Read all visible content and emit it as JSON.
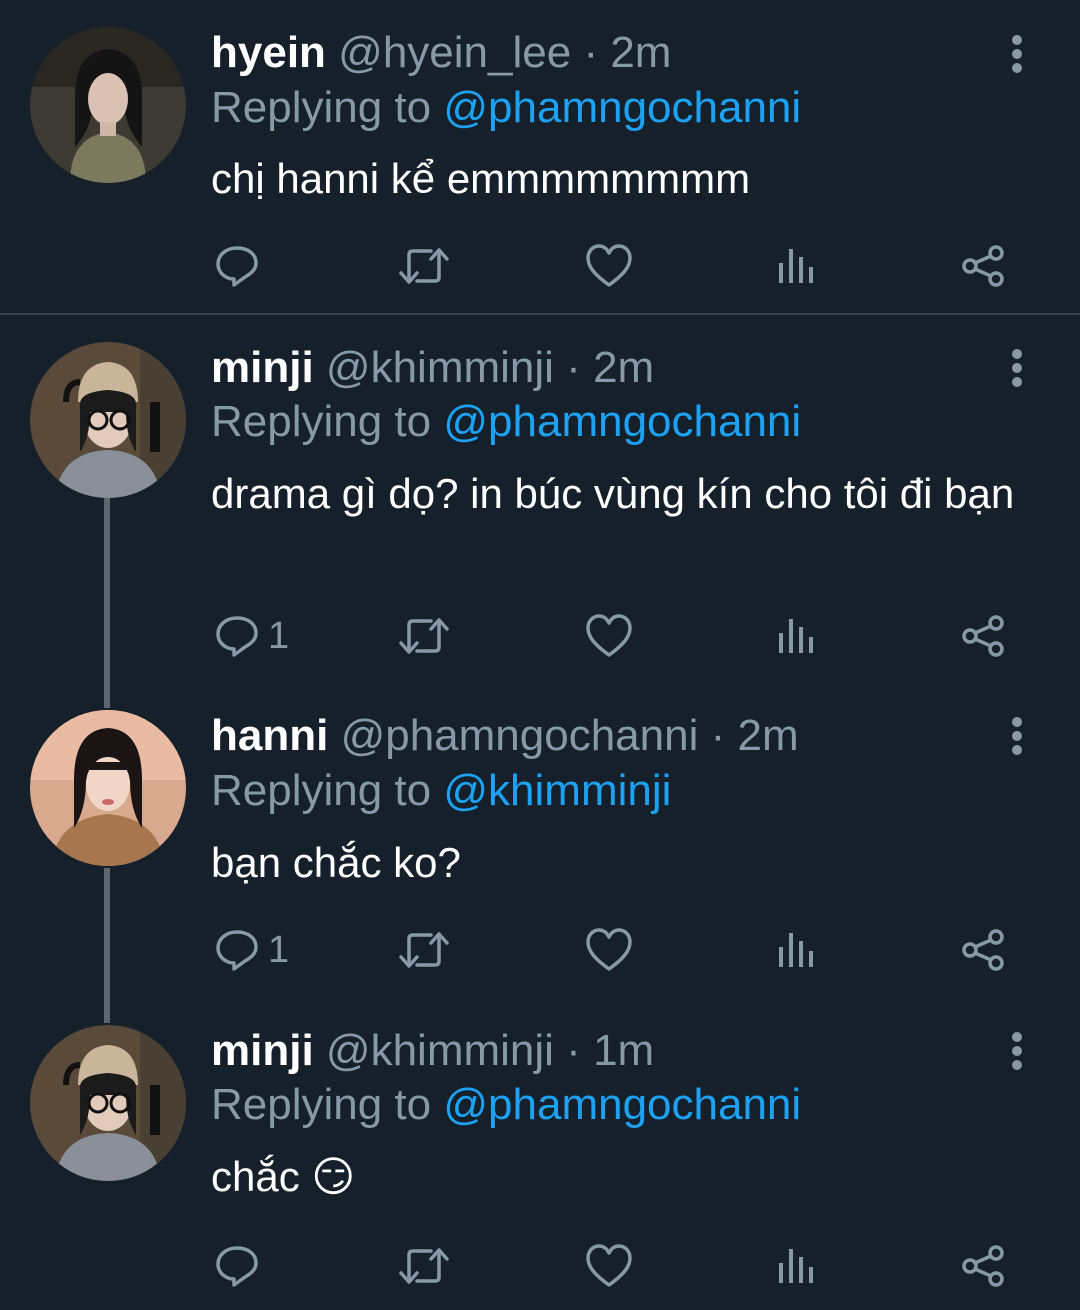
{
  "colors": {
    "background": "#15202b",
    "text": "#ffffff",
    "secondary": "#8899a6",
    "link": "#1da1f2",
    "divider": "#38444d",
    "thread_line": "#5b6670"
  },
  "labels": {
    "replying_to": "Replying to",
    "separator": "·"
  },
  "tweets": [
    {
      "name": "hyein",
      "handle": "@hyein_lee",
      "time": "2m",
      "reply_to": "@phamngochanni",
      "text": "chị hanni kể emmmmmmmm",
      "reply_count": "",
      "avatar_icon": "user-avatar-photo"
    },
    {
      "name": "minji",
      "handle": "@khimminji",
      "time": "2m",
      "reply_to": "@phamngochanni",
      "text": "drama gì dọ? in búc vùng kín cho tôi đi bạn",
      "reply_count": "1",
      "avatar_icon": "user-avatar-photo"
    },
    {
      "name": "hanni",
      "handle": "@phamngochanni",
      "time": "2m",
      "reply_to": "@khimminji",
      "text": "bạn chắc ko?",
      "reply_count": "1",
      "avatar_icon": "user-avatar-photo"
    },
    {
      "name": "minji",
      "handle": "@khimminji",
      "time": "1m",
      "reply_to": "@phamngochanni",
      "text": "chắc 😏",
      "reply_count": "",
      "avatar_icon": "user-avatar-photo"
    }
  ],
  "action_icons": [
    "reply-icon",
    "retweet-icon",
    "like-icon",
    "analytics-icon",
    "share-icon"
  ]
}
